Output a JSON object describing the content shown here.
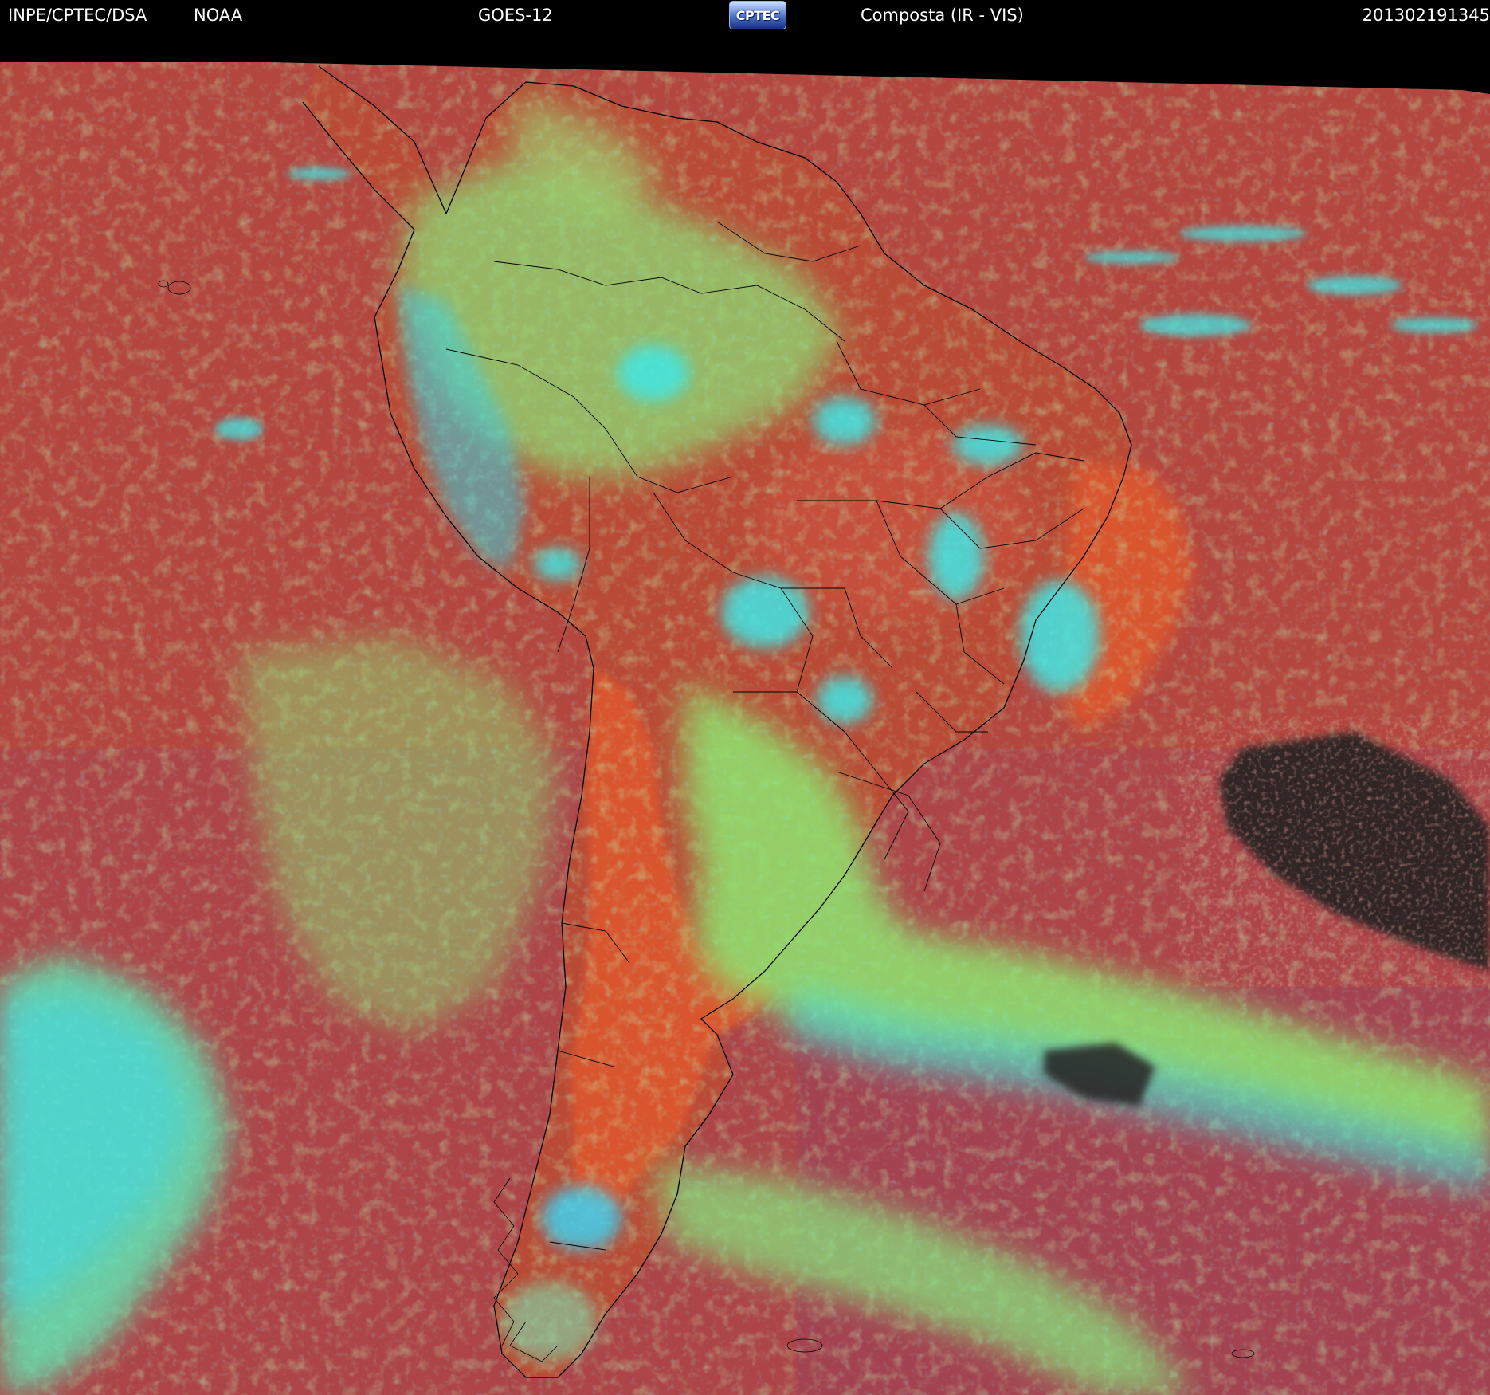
{
  "header": {
    "agency": "INPE/CPTEC/DSA",
    "source": "NOAA",
    "satellite": "GOES-12",
    "logo_text": "CPTEC",
    "product": "Composta (IR - VIS)",
    "timestamp": "201302191345"
  },
  "map": {
    "region": "South America",
    "palette": {
      "background_ocean": "#b3463f",
      "land_clear": "#d9552e",
      "clouds_low": "#8ee86c",
      "clouds_high": "#39e7e4",
      "dark_void": "#262320",
      "outline": "#000000"
    }
  }
}
